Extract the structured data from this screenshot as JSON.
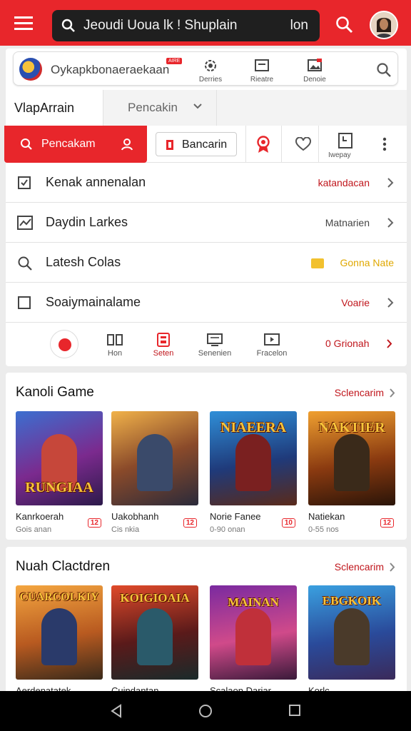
{
  "search": {
    "query": "Jeoudi Uoua lk ! Shuplain",
    "query_suffix": "lon"
  },
  "subbar": {
    "title": "Oykapkbonaeraekaan",
    "badge": "AIRE",
    "items": [
      {
        "icon": "gear-icon",
        "label": "Derries"
      },
      {
        "icon": "card-icon",
        "label": "Rieatre"
      },
      {
        "icon": "image-icon",
        "label": "Denoie"
      }
    ]
  },
  "tabs": {
    "active": "VlapArrain",
    "second": "Pencakin"
  },
  "actions": {
    "primary": "Pencakam",
    "secondary": "Bancarin",
    "third_label": "Iwepay"
  },
  "rows": [
    {
      "label": "Kenak annenalan",
      "value": "katandacan",
      "icon": "checkbox-icon"
    },
    {
      "label": "Daydin Larkes",
      "value": "Matnarien",
      "icon": "chart-icon"
    },
    {
      "label": "Latesh Colas",
      "value": "Gonna Nate",
      "icon": "search-icon"
    },
    {
      "label": "Soaiymainalame",
      "value": "Voarie",
      "icon": "square-icon"
    }
  ],
  "bottomnav": {
    "items": [
      {
        "label": "Hon",
        "icon": "book-icon"
      },
      {
        "label": "Seten",
        "icon": "calculator-icon"
      },
      {
        "label": "Senenien",
        "icon": "monitor-icon"
      },
      {
        "label": "Fracelon",
        "icon": "play-icon"
      }
    ],
    "last": "0 Grionah"
  },
  "sections": [
    {
      "title": "Kanoli Game",
      "more": "Sclencarim",
      "games": [
        {
          "art_title": "RUNGIAA",
          "name": "Kanrkoerah",
          "sub": "Gois anan",
          "tag": "12"
        },
        {
          "art_title": "",
          "name": "Uakobhanh",
          "sub": "Cis nkia",
          "tag": "12"
        },
        {
          "art_title": "NIAEERA",
          "name": "Norie Fanee",
          "sub": "0-90 onan",
          "tag": "10"
        },
        {
          "art_title": "NAKTIER",
          "name": "Natiekan",
          "sub": "0-55 nos",
          "tag": "12"
        }
      ]
    },
    {
      "title": "Nuah Clactdren",
      "more": "Sclencarim",
      "games": [
        {
          "art_title": "CUARCOLKIY",
          "name": "Aerdenatatek",
          "sub": "",
          "tag": ""
        },
        {
          "art_title": "KOIGIOAIA",
          "name": "Cuindantan",
          "sub": "",
          "tag": ""
        },
        {
          "art_title": "MAINAN",
          "name": "Scalaon Dariar",
          "sub": "",
          "tag": ""
        },
        {
          "art_title": "EBGKOIK",
          "name": "Korlc",
          "sub": "",
          "tag": ""
        }
      ]
    }
  ],
  "colors": {
    "accent": "#e8262b",
    "dark": "#1f1f1f",
    "gold": "#f2c12e"
  }
}
